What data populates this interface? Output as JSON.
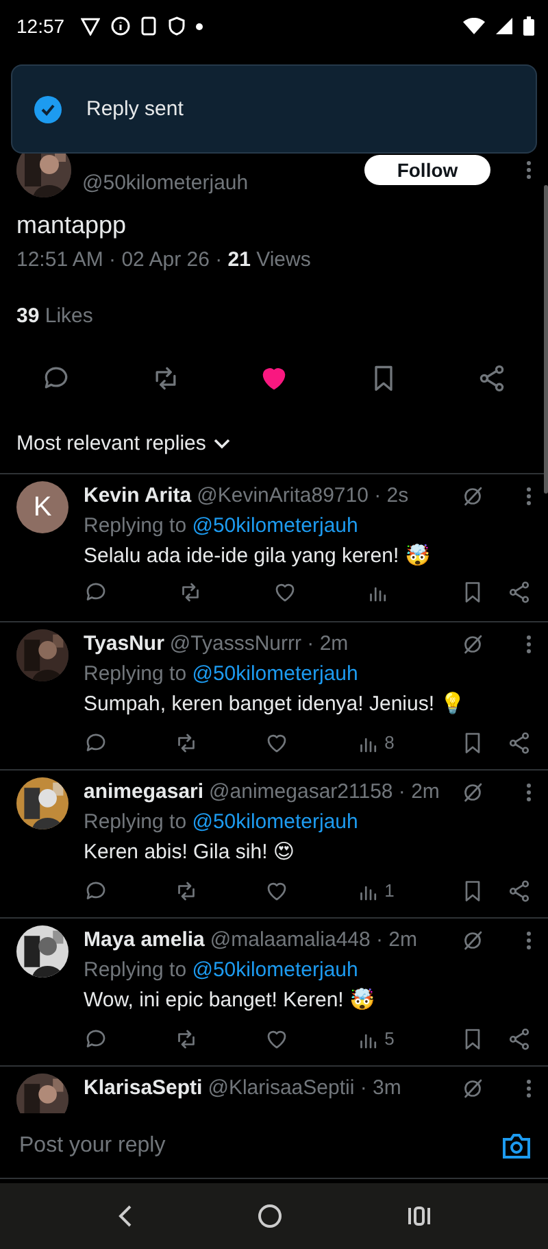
{
  "status_bar": {
    "time": "12:57"
  },
  "toast": {
    "message": "Reply sent"
  },
  "post": {
    "handle": "@50kilometerjauh",
    "follow_label": "Follow",
    "text": "mantappp",
    "time": "12:51 AM · 02 Apr 26 · ",
    "views_count": "21",
    "views_label": " Views",
    "likes_count": "39",
    "likes_label": " Likes",
    "liked": true,
    "bookmarked": false
  },
  "sort": {
    "label": "Most relevant replies"
  },
  "replies": [
    {
      "kind": "letter",
      "avatar_letter": "K",
      "name": "Kevin Arita",
      "handle": "@KevinArita89710 · 2s",
      "replying_prefix": "Replying to ",
      "replying_to": "@50kilometerjauh",
      "text": "Selalu ada ide-ide gila yang keren! 🤯",
      "liked": false
    },
    {
      "kind": "picture",
      "name": "TyasNur",
      "handle": "@TyasssNurrr · 2m",
      "replying_prefix": "Replying to ",
      "replying_to": "@50kilometerjauh",
      "text": "Sumpah, keren banget idenya! Jenius! 💡",
      "views": "8",
      "liked": false
    },
    {
      "kind": "picture",
      "name": "animegasari",
      "handle": "@animegasar21158 · 2m",
      "replying_prefix": "Replying to ",
      "replying_to": "@50kilometerjauh",
      "text": "Keren abis! Gila sih! 😍",
      "views": "1",
      "liked": false
    },
    {
      "kind": "picture",
      "name": "Maya amelia",
      "handle": "@malaamalia448 · 2m",
      "replying_prefix": "Replying to ",
      "replying_to": "@50kilometerjauh",
      "text": "Wow, ini epic banget! Keren! 🤯",
      "views": "5",
      "liked": false
    },
    {
      "kind": "picture",
      "name": "KlarisaSepti",
      "handle": "@KlarisaaSeptii · 3m"
    }
  ],
  "composer": {
    "placeholder": "Post your reply"
  }
}
